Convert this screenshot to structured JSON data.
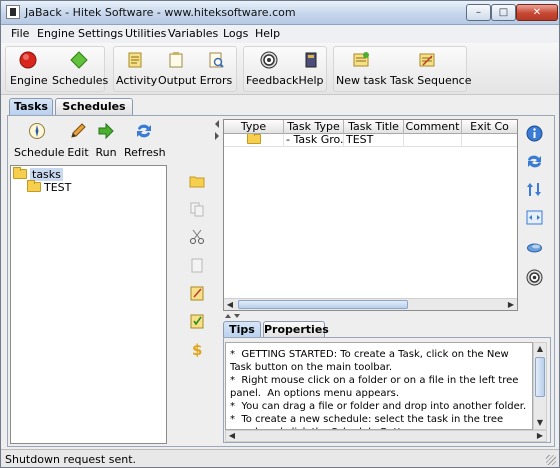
{
  "window": {
    "title": "JaBack   -   Hitek Software - www.hiteksoftware.com",
    "minimize": "–",
    "maximize": "□",
    "close": "✕"
  },
  "menu": [
    "File",
    "Engine",
    "Settings",
    "Utilities",
    "Variables",
    "Logs",
    "Help"
  ],
  "main_toolbar": {
    "engine": "Engine",
    "schedules": "Schedules",
    "activity": "Activity",
    "output": "Output",
    "errors": "Errors",
    "feedback": "Feedback",
    "help": "Help",
    "new_task": "New task",
    "task_sequence": "Task Sequence"
  },
  "main_tabs": {
    "tasks": "Tasks",
    "schedules": "Schedules"
  },
  "left_toolbar": {
    "schedule": "Schedule",
    "edit": "Edit",
    "run": "Run",
    "refresh": "Refresh"
  },
  "tree": {
    "root": "tasks",
    "child": "TEST"
  },
  "table": {
    "columns": [
      "Type",
      "Task Type",
      "Task Title",
      "Comment",
      "Exit Co"
    ],
    "rows": [
      {
        "type_icon": "folder-icon",
        "task_type": "- Task Gro...",
        "task_title": "TEST",
        "comment": "",
        "exit": ""
      }
    ]
  },
  "tips_tabs": {
    "tips": "Tips",
    "properties": "Properties"
  },
  "tips_text": "*  GETTING STARTED: To create a Task, click on the New Task button on the main toolbar.\n*  Right mouse click on a folder or on a file in the left tree panel.  An options menu appears.\n*  You can drag a file or folder and drop into another folder.\n*  To create a new schedule: select the task in the tree panel, and click the Schedule Button.",
  "status": "Shutdown request sent.",
  "colors": {
    "accent": "#b9d0ee",
    "tree_selected": "#c9d9ef",
    "folder": "#f5cf4d"
  }
}
